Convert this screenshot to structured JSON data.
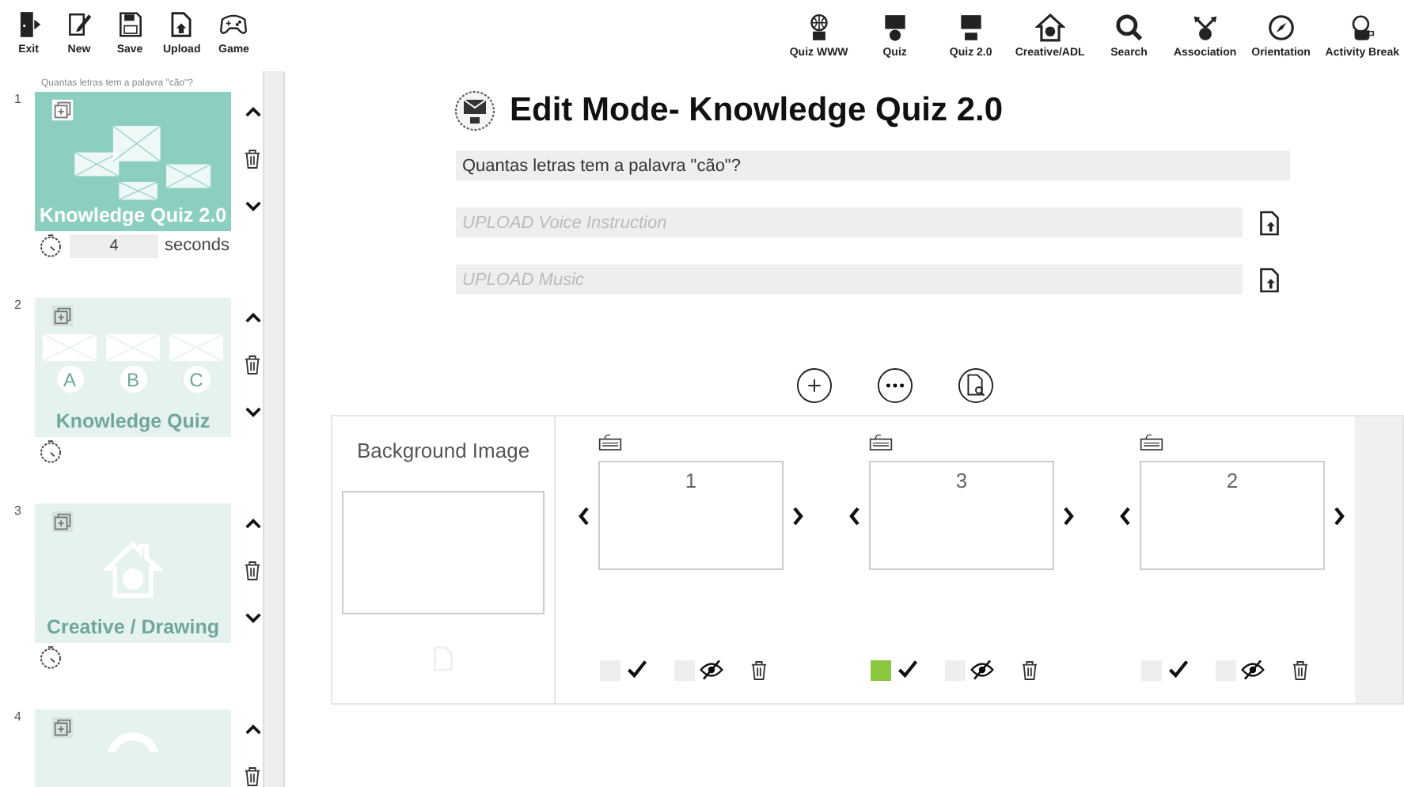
{
  "toolbar_left": [
    {
      "label": "Exit"
    },
    {
      "label": "New"
    },
    {
      "label": "Save"
    },
    {
      "label": "Upload"
    },
    {
      "label": "Game"
    }
  ],
  "toolbar_right": [
    {
      "label": "Quiz WWW"
    },
    {
      "label": "Quiz"
    },
    {
      "label": "Quiz 2.0"
    },
    {
      "label": "Creative/ADL"
    },
    {
      "label": "Search"
    },
    {
      "label": "Association"
    },
    {
      "label": "Orientation"
    },
    {
      "label": "Activity Break"
    }
  ],
  "sidebar": {
    "question_hint": "Quantas letras tem a palavra \"cão\"?",
    "slides": [
      {
        "number": "1",
        "kind": "quiz2",
        "title": "Knowledge Quiz 2.0",
        "selected": true,
        "duration": "4",
        "duration_unit": "seconds"
      },
      {
        "number": "2",
        "kind": "quiz",
        "title": "Knowledge Quiz",
        "selected": false,
        "letters": [
          "A",
          "B",
          "C"
        ]
      },
      {
        "number": "3",
        "kind": "creative",
        "title": "Creative / Drawing",
        "selected": false
      },
      {
        "number": "4",
        "kind": "search",
        "selected": false
      }
    ]
  },
  "editor": {
    "title": "Edit Mode- Knowledge Quiz 2.0",
    "question": "Quantas letras tem a palavra \"cão\"?",
    "voice_placeholder": "UPLOAD Voice Instruction",
    "music_placeholder": "UPLOAD Music"
  },
  "answers_panel": {
    "background_label": "Background Image",
    "answers": [
      {
        "text": "1",
        "correct": false,
        "hidden": false
      },
      {
        "text": "3",
        "correct": true,
        "hidden": false
      },
      {
        "text": "2",
        "correct": false,
        "hidden": false
      }
    ]
  }
}
